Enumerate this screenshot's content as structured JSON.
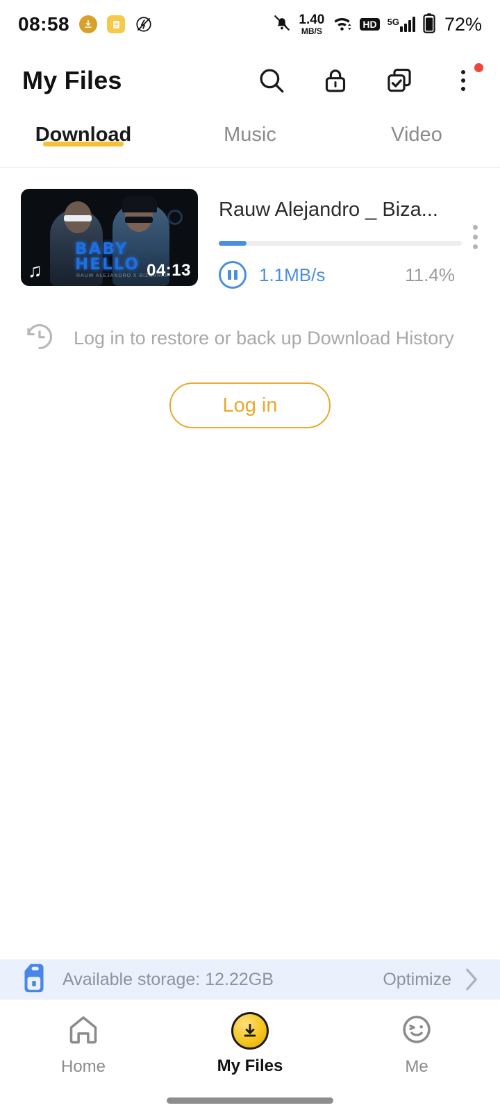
{
  "status_bar": {
    "time": "08:58",
    "icons_left": [
      "download-badge-icon",
      "note-badge-icon",
      "no-signal-circle-icon"
    ],
    "net_speed_value": "1.40",
    "net_speed_unit": "MB/S",
    "mute_icon": "bell-muted-icon",
    "wifi_icon": "wifi-icon",
    "hd_label": "HD",
    "network_gen": "5G",
    "battery": "72%"
  },
  "header": {
    "title": "My Files",
    "actions": [
      {
        "name": "search-icon",
        "label": "Search"
      },
      {
        "name": "lock-icon",
        "label": "Private"
      },
      {
        "name": "select-copy-icon",
        "label": "Select"
      },
      {
        "name": "overflow-menu-icon",
        "label": "More",
        "badge": true
      }
    ]
  },
  "tabs": [
    {
      "label": "Download",
      "active": true
    },
    {
      "label": "Music",
      "active": false
    },
    {
      "label": "Video",
      "active": false
    }
  ],
  "download_item": {
    "title": "Rauw Alejandro _ Biza...",
    "duration": "04:13",
    "speed": "1.1MB/s",
    "percent_label": "11.4%",
    "percent_value": 11.4,
    "state_icon": "pause-icon",
    "media_type_icon": "music-note-icon",
    "thumbnail": {
      "line1": "BABY",
      "line2": "HELLO",
      "credit": "RAUW ALEJANDRO X BIZARRAP"
    }
  },
  "login_prompt": {
    "icon": "history-clock-icon",
    "text": "Log in to restore or back up Download History",
    "button_label": "Log in"
  },
  "storage_bar": {
    "icon": "sd-card-icon",
    "text": "Available storage: 12.22GB",
    "action_label": "Optimize",
    "chevron": "chevron-right-icon"
  },
  "bottom_nav": [
    {
      "label": "Home",
      "icon": "home-icon",
      "active": false
    },
    {
      "label": "My Files",
      "icon": "download-circle-icon",
      "active": true
    },
    {
      "label": "Me",
      "icon": "smiley-face-icon",
      "active": false
    }
  ],
  "colors": {
    "accent_yellow": "#F5C033",
    "login_orange": "#E8A92D",
    "progress_blue": "#4B8EDE",
    "storage_bg": "#EAF1FC",
    "badge_red": "#F0453A"
  }
}
